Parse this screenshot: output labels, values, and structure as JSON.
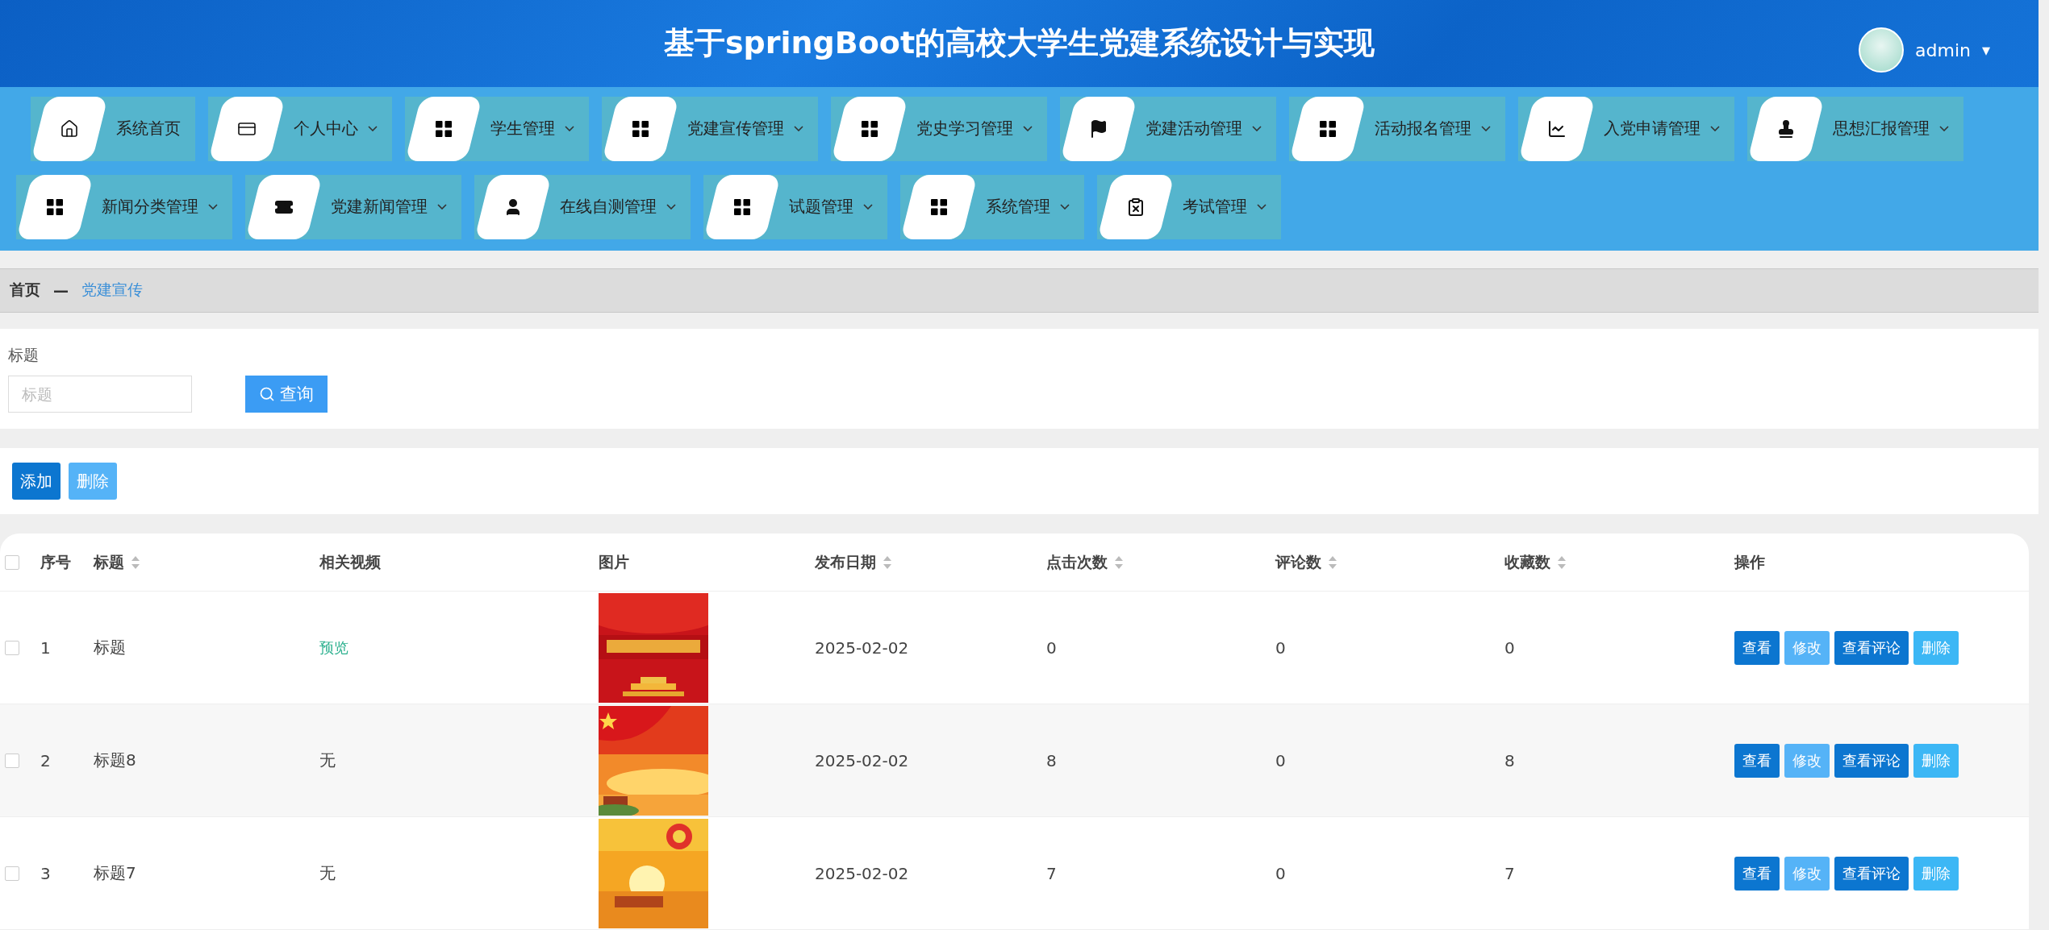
{
  "header": {
    "title": "基于springBoot的高校大学生党建系统设计与实现",
    "user": "admin",
    "user_caret": "▾"
  },
  "nav": {
    "rows": [
      [
        {
          "label": "系统首页",
          "kind": "home",
          "dropdown": false
        },
        {
          "label": "个人中心",
          "kind": "card",
          "dropdown": true
        },
        {
          "label": "学生管理",
          "kind": "grid",
          "dropdown": true
        },
        {
          "label": "党建宣传管理",
          "kind": "grid",
          "dropdown": true
        },
        {
          "label": "党史学习管理",
          "kind": "grid",
          "dropdown": true
        },
        {
          "label": "党建活动管理",
          "kind": "flag",
          "dropdown": true
        },
        {
          "label": "活动报名管理",
          "kind": "grid",
          "dropdown": true
        },
        {
          "label": "入党申请管理",
          "kind": "chart",
          "dropdown": true
        },
        {
          "label": "思想汇报管理",
          "kind": "stamp",
          "dropdown": true
        }
      ],
      [
        {
          "label": "新闻分类管理",
          "kind": "grid",
          "dropdown": true
        },
        {
          "label": "党建新闻管理",
          "kind": "ticket",
          "dropdown": true
        },
        {
          "label": "在线自测管理",
          "kind": "user",
          "dropdown": true
        },
        {
          "label": "试题管理",
          "kind": "grid",
          "dropdown": true
        },
        {
          "label": "系统管理",
          "kind": "grid",
          "dropdown": true
        },
        {
          "label": "考试管理",
          "kind": "clipboard",
          "dropdown": true
        }
      ]
    ]
  },
  "breadcrumb": {
    "home": "首页",
    "separator": "—",
    "current": "党建宣传"
  },
  "search": {
    "label": "标题",
    "placeholder": "标题",
    "button": "查询"
  },
  "toolbar": [
    {
      "label": "添加",
      "kind": "primary"
    },
    {
      "label": "删除",
      "kind": "light"
    }
  ],
  "table": {
    "select_all": {
      "checked": false
    },
    "columns": [
      {
        "label": "序号",
        "sortable": false
      },
      {
        "label": "标题",
        "sortable": true
      },
      {
        "label": "相关视频",
        "sortable": false
      },
      {
        "label": "图片",
        "sortable": false
      },
      {
        "label": "发布日期",
        "sortable": true
      },
      {
        "label": "点击次数",
        "sortable": true
      },
      {
        "label": "评论数",
        "sortable": true
      },
      {
        "label": "收藏数",
        "sortable": true
      },
      {
        "label": "操作",
        "sortable": false
      }
    ],
    "rows": [
      {
        "checked": false,
        "index": "1",
        "title": "标题",
        "video": {
          "text": "预览",
          "kind": "link"
        },
        "date": "2025-02-02",
        "clicks": "0",
        "comments": "0",
        "favorites": "0",
        "actions": [
          {
            "label": "查看",
            "kind": "primary"
          },
          {
            "label": "修改",
            "kind": "light"
          },
          {
            "label": "查看评论",
            "kind": "primary"
          },
          {
            "label": "删除",
            "kind": "info"
          }
        ]
      },
      {
        "checked": false,
        "index": "2",
        "title": "标题8",
        "video": {
          "text": "无",
          "kind": "text"
        },
        "date": "2025-02-02",
        "clicks": "8",
        "comments": "0",
        "favorites": "8",
        "actions": [
          {
            "label": "查看",
            "kind": "primary"
          },
          {
            "label": "修改",
            "kind": "light"
          },
          {
            "label": "查看评论",
            "kind": "primary"
          },
          {
            "label": "删除",
            "kind": "info"
          }
        ]
      },
      {
        "checked": false,
        "index": "3",
        "title": "标题7",
        "video": {
          "text": "无",
          "kind": "text"
        },
        "date": "2025-02-02",
        "clicks": "7",
        "comments": "0",
        "favorites": "7",
        "actions": [
          {
            "label": "查看",
            "kind": "primary"
          },
          {
            "label": "修改",
            "kind": "light"
          },
          {
            "label": "查看评论",
            "kind": "primary"
          },
          {
            "label": "删除",
            "kind": "info"
          }
        ]
      }
    ]
  }
}
